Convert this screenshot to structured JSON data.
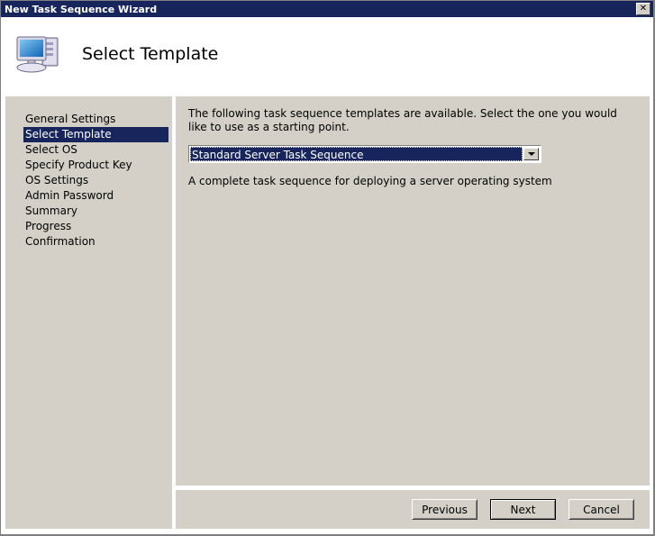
{
  "window": {
    "title": "New Task Sequence Wizard",
    "close_label": "✕",
    "titlebar_color": "#17255c",
    "panel_color": "#d4d0c8"
  },
  "header": {
    "icon": "computer-icon",
    "title": "Select Template"
  },
  "sidebar": {
    "items": [
      {
        "label": "General Settings",
        "active": false
      },
      {
        "label": "Select Template",
        "active": true
      },
      {
        "label": "Select OS",
        "active": false
      },
      {
        "label": "Specify Product Key",
        "active": false
      },
      {
        "label": "OS Settings",
        "active": false
      },
      {
        "label": "Admin Password",
        "active": false
      },
      {
        "label": "Summary",
        "active": false
      },
      {
        "label": "Progress",
        "active": false
      },
      {
        "label": "Confirmation",
        "active": false
      }
    ]
  },
  "main": {
    "intro": "The following task sequence templates are available.  Select the one you would like to use as a starting point.",
    "combo": {
      "selected": "Standard Server Task Sequence",
      "arrow_icon": "chevron-down-icon"
    },
    "description": "A complete task sequence for deploying a server operating system"
  },
  "buttons": {
    "previous": "Previous",
    "next": "Next",
    "cancel": "Cancel"
  }
}
